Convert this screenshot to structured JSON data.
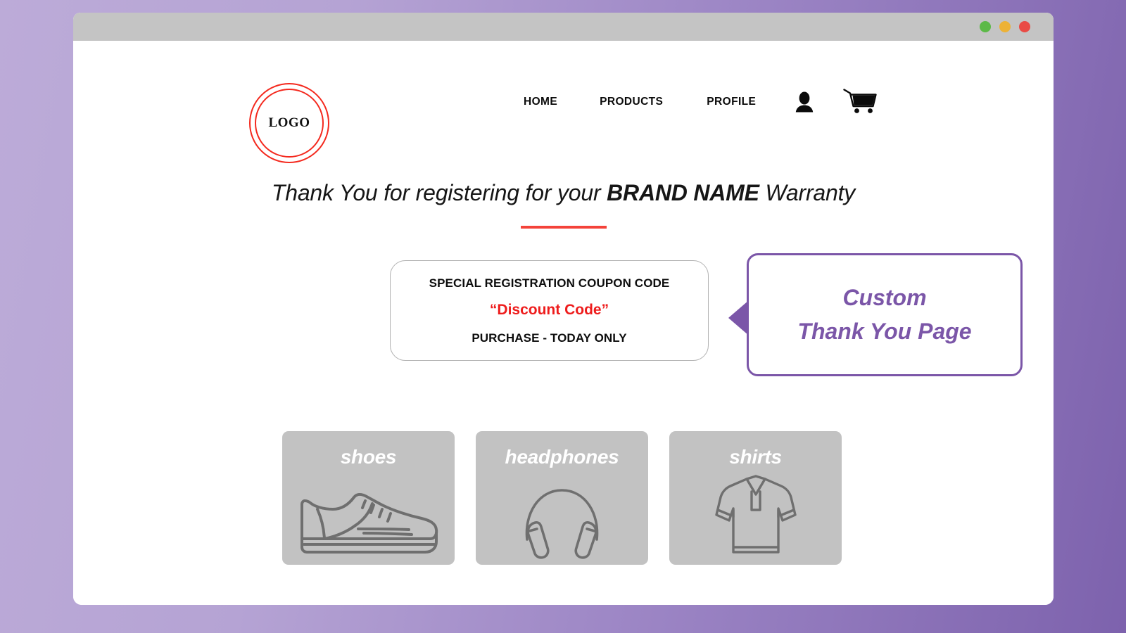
{
  "window": {
    "dots": [
      {
        "name": "minimize",
        "color": "#5cb947"
      },
      {
        "name": "maximize",
        "color": "#edb236"
      },
      {
        "name": "close",
        "color": "#e94b45"
      }
    ]
  },
  "header": {
    "logo_text": "LOGO",
    "logo_color": "#f4291e",
    "nav": [
      {
        "id": "home",
        "label": "HOME"
      },
      {
        "id": "products",
        "label": "PRODUCTS"
      },
      {
        "id": "profile",
        "label": "PROFILE"
      }
    ],
    "icons": [
      {
        "name": "person-icon",
        "label": "Account"
      },
      {
        "name": "cart-icon",
        "label": "Cart"
      }
    ]
  },
  "hero": {
    "title_prefix": "Thank You for registering for your ",
    "title_brand": "BRAND NAME",
    "title_suffix": " Warranty",
    "divider_color": "#f4433a"
  },
  "coupon": {
    "heading": "SPECIAL REGISTRATION COUPON CODE",
    "code": "“Discount Code”",
    "code_color": "#ee1c1c",
    "footnote": "PURCHASE - TODAY ONLY"
  },
  "callout": {
    "line1": "Custom",
    "line2": "Thank You Page",
    "accent_color": "#7b56a8"
  },
  "products": [
    {
      "id": "shoes",
      "label": "shoes",
      "icon": "sneaker-icon"
    },
    {
      "id": "headphones",
      "label": "headphones",
      "icon": "headphones-icon"
    },
    {
      "id": "shirts",
      "label": "shirts",
      "icon": "polo-shirt-icon"
    }
  ],
  "theme": {
    "background_light": "#bcabd8",
    "background_dark": "#7d62ad",
    "title_bar": "#c4c4c4",
    "card_gray": "#c2c2c2",
    "card_art_stroke": "#6f6f6f"
  }
}
